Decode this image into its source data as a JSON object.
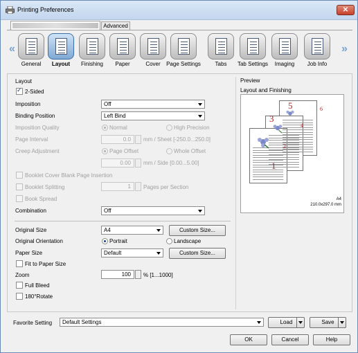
{
  "window": {
    "title": "Printing Preferences",
    "close": "✕"
  },
  "tabs": {
    "advanced": "Advanced"
  },
  "toolbar": {
    "items": [
      "General",
      "Layout",
      "Finishing",
      "Paper",
      "Cover",
      "Page Settings",
      "Tabs",
      "Tab Settings",
      "Imaging",
      "Job Info"
    ],
    "selected": "Layout"
  },
  "layout": {
    "section": "Layout",
    "two_sided": "2-Sided",
    "imposition_label": "Imposition",
    "imposition_value": "Off",
    "binding_label": "Binding Position",
    "binding_value": "Left Bind",
    "quality_label": "Imposition Quality",
    "quality_normal": "Normal",
    "quality_high": "High Precision",
    "page_interval_label": "Page Interval",
    "page_interval_value": "0.0",
    "page_interval_unit": "mm / Sheet [-250.0...250.0]",
    "creep_label": "Creep Adjustment",
    "creep_page_offset": "Page Offset",
    "creep_whole_offset": "Whole Offset",
    "creep_value": "0.00",
    "creep_unit": "mm / Side [0.00...5.00]",
    "booklet_blank": "Booklet Cover Blank Page Insertion",
    "booklet_split": "Booklet Splitting",
    "booklet_split_value": "1",
    "booklet_split_unit": "Pages per Section",
    "book_spread": "Book Spread",
    "combination_label": "Combination",
    "combination_value": "Off",
    "original_size_label": "Original Size",
    "original_size_value": "A4",
    "custom_size_btn1": "Custom Size...",
    "orientation_label": "Original Orientation",
    "portrait": "Portrait",
    "landscape": "Landscape",
    "paper_size_label": "Paper Size",
    "paper_size_value": "Default",
    "custom_size_btn2": "Custom Size...",
    "fit_to_paper": "Fit to Paper Size",
    "zoom_label": "Zoom",
    "zoom_value": "100",
    "zoom_unit": "% [1...1000]",
    "full_bleed": "Full Bleed",
    "rotate": "180°Rotate"
  },
  "preview": {
    "section": "Preview",
    "title": "Layout and Finishing",
    "paper": "A4",
    "dims": "210.0x297.0 mm",
    "page_numbers": [
      "1",
      "2",
      "3",
      "4",
      "5",
      "6"
    ]
  },
  "footer": {
    "favorite_label": "Favorite Setting",
    "favorite_value": "Default Settings",
    "load": "Load",
    "save": "Save",
    "ok": "OK",
    "cancel": "Cancel",
    "help": "Help"
  }
}
